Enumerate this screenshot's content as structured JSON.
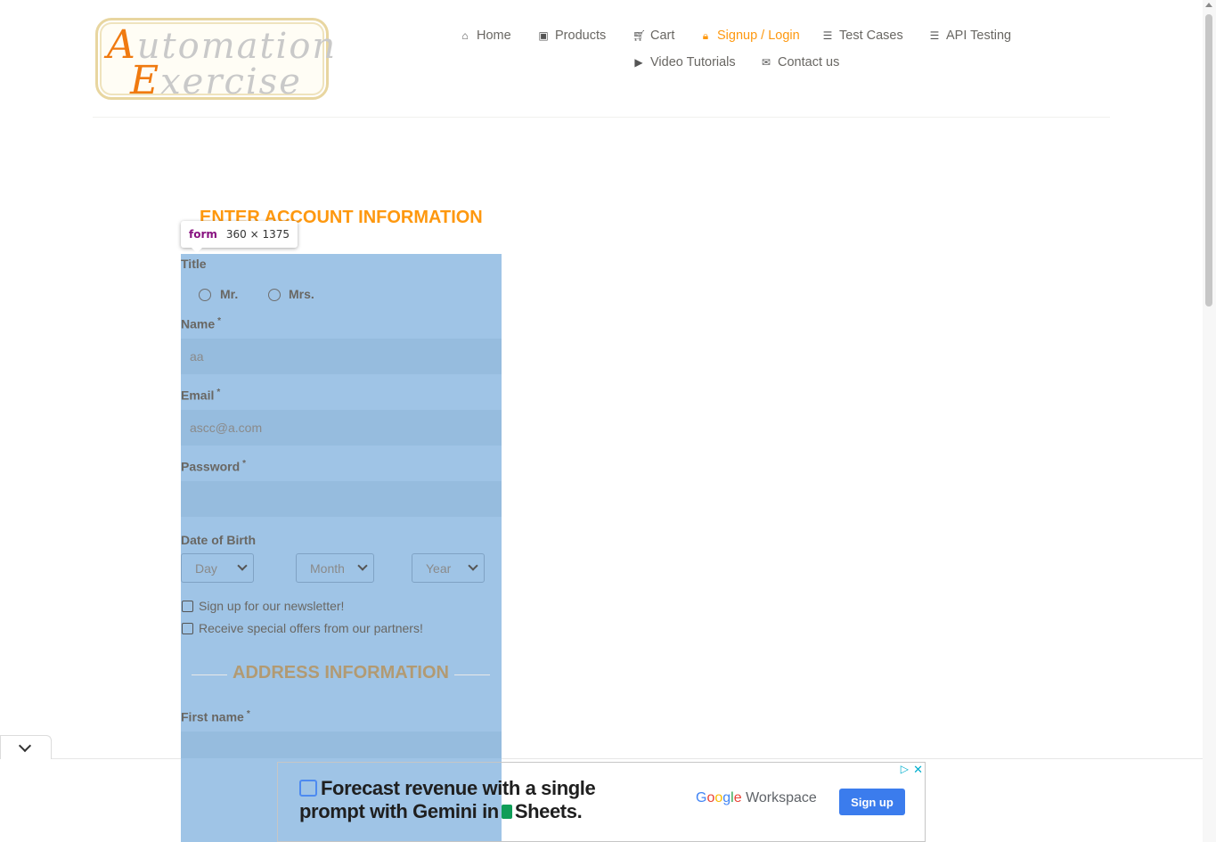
{
  "logo": {
    "line1_cap": "A",
    "line1_rest": "utomation",
    "line2_cap": "E",
    "line2_rest": "xercise"
  },
  "nav": {
    "items": [
      {
        "label": "Home",
        "icon": "home-icon"
      },
      {
        "label": "Products",
        "icon": "products-icon"
      },
      {
        "label": "Cart",
        "icon": "cart-icon"
      },
      {
        "label": "Signup / Login",
        "icon": "lock-icon",
        "active": true
      },
      {
        "label": "Test Cases",
        "icon": "list-icon"
      },
      {
        "label": "API Testing",
        "icon": "list-icon"
      },
      {
        "label": "Video Tutorials",
        "icon": "youtube-icon"
      },
      {
        "label": "Contact us",
        "icon": "envelope-icon"
      }
    ],
    "active_color": "#fe980f"
  },
  "devtools_tooltip": {
    "tag": "form",
    "size": "360 × 1375"
  },
  "account": {
    "title": "ENTER ACCOUNT INFORMATION",
    "title_label": "Title",
    "title_options": [
      "Mr.",
      "Mrs."
    ],
    "name_label": "Name",
    "name_value": "aa",
    "email_label": "Email",
    "email_value": "ascc@a.com",
    "password_label": "Password",
    "password_value": "",
    "required_mark": "*",
    "dob_label": "Date of Birth",
    "dob_day": "Day",
    "dob_month": "Month",
    "dob_year": "Year",
    "newsletter_label": "Sign up for our newsletter!",
    "offers_label": "Receive special offers from our partners!"
  },
  "address": {
    "title": "ADDRESS INFORMATION",
    "first_name_label": "First name"
  },
  "ad": {
    "headline_line1": "Forecast revenue with a single",
    "headline_line2_a": "prompt with Gemini in",
    "headline_line2_b": "Sheets.",
    "brand_google": "Google",
    "brand_workspace": "Workspace",
    "cta": "Sign up",
    "close": "✕",
    "adchoices": "▷"
  },
  "colors": {
    "accent": "#fe980f",
    "highlight": "#9fc4e6",
    "ad_button": "#3b7ced"
  }
}
